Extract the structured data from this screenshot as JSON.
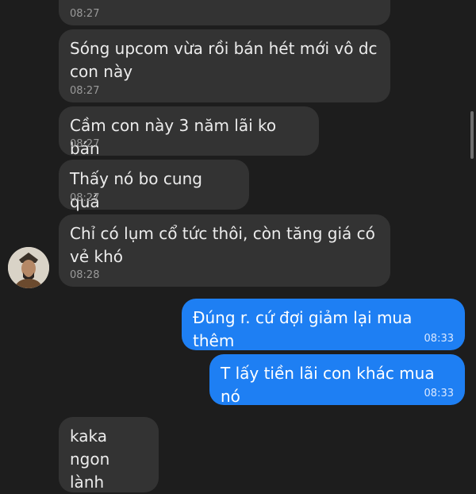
{
  "messages": [
    {
      "direction": "in",
      "text": "",
      "time": "08:27"
    },
    {
      "direction": "in",
      "text": "Sóng upcom vừa rồi bán hét mới vô dc\ncon này",
      "time": "08:27"
    },
    {
      "direction": "in",
      "text": "Cầm con này 3 năm lãi ko bán",
      "time": "08:27"
    },
    {
      "direction": "in",
      "text": "Thấy nó bo cung quá",
      "time": "08:27"
    },
    {
      "direction": "in",
      "text": "Chỉ có lụm cổ tức thôi, còn tăng giá có\nvẻ khó",
      "time": "08:28"
    },
    {
      "direction": "out",
      "text": "Đúng r. cứ đợi giảm lại mua thêm",
      "time": "08:33"
    },
    {
      "direction": "out",
      "text": "T lấy tiền lãi con khác mua nó",
      "time": "08:33"
    },
    {
      "direction": "in",
      "text": "kaka\nngon lành",
      "time": ""
    }
  ],
  "avatar": {
    "icon": "contact-avatar-icon"
  },
  "colors": {
    "incoming_bubble": "#333333",
    "outgoing_bubble": "#1e7ff3",
    "background": "#1d1d1d"
  }
}
